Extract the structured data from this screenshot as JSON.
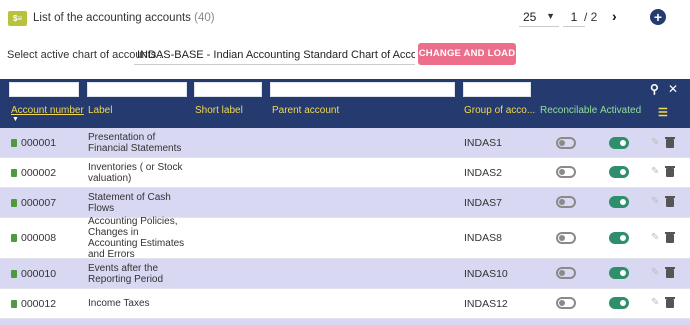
{
  "header": {
    "icon": "list-money-icon",
    "title": "List of the accounting accounts",
    "count": "(40)",
    "page_size": "25",
    "current_page": "1",
    "page_total": "/ 2",
    "next_icon": "chevron-right-icon",
    "add_icon": "plus-circle-icon"
  },
  "chart_selector": {
    "label": "Select active chart of accounts :",
    "value": "INDAS-BASE - Indian Accounting Standard Chart of Accounts - (IN)",
    "button": "CHANGE AND LOAD"
  },
  "table": {
    "columns": {
      "account_number": "Account number",
      "label": "Label",
      "short_label": "Short label",
      "parent_account": "Parent account",
      "group": "Group of acco...",
      "reconcilable": "Reconcilable",
      "activated": "Activated"
    },
    "rows": [
      {
        "number": "000001",
        "label": "Presentation of Financial Statements",
        "group": "INDAS1",
        "reconcilable": false,
        "activated": true
      },
      {
        "number": "000002",
        "label": "Inventories ( or Stock valuation)",
        "group": "INDAS2",
        "reconcilable": false,
        "activated": true
      },
      {
        "number": "000007",
        "label": "Statement of Cash Flows",
        "group": "INDAS7",
        "reconcilable": false,
        "activated": true
      },
      {
        "number": "000008",
        "label": "Accounting Policies, Changes in Accounting Estimates and Errors",
        "group": "INDAS8",
        "reconcilable": false,
        "activated": true
      },
      {
        "number": "000010",
        "label": "Events after the Reporting Period",
        "group": "INDAS10",
        "reconcilable": false,
        "activated": true
      },
      {
        "number": "000012",
        "label": "Income Taxes",
        "group": "INDAS12",
        "reconcilable": false,
        "activated": true
      }
    ]
  },
  "colors": {
    "header_bg": "#253a6e",
    "accent_pink": "#ec6e8b",
    "toggle_on": "#2f8f6c",
    "row_highlight": "#d8d8f2"
  }
}
